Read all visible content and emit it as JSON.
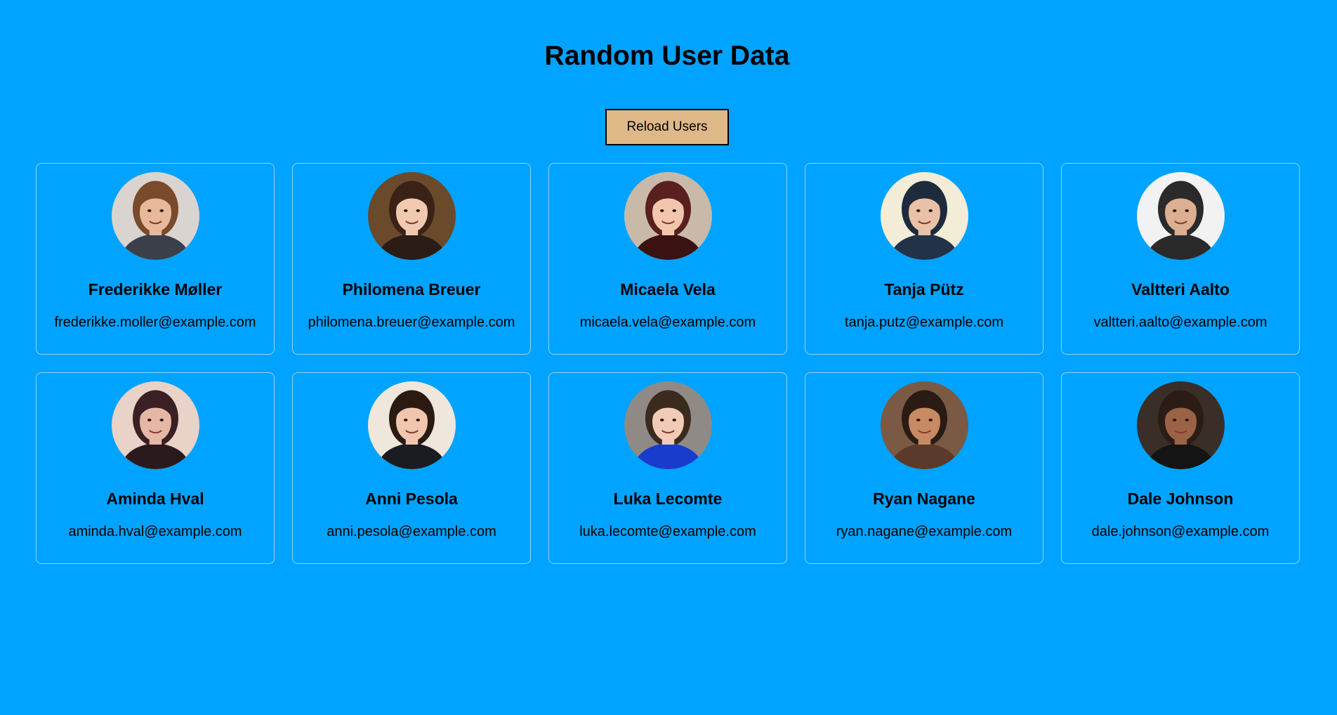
{
  "header": {
    "title": "Random User Data"
  },
  "toolbar": {
    "reload_label": "Reload Users"
  },
  "theme": {
    "background": "#00a3ff",
    "button_bg": "#deb887"
  },
  "users": [
    {
      "name": "Frederikke Møller",
      "email": "frederikke.moller@example.com",
      "avatar_icon": "user-avatar",
      "bg": "#d9d4cf",
      "skin": "#e7b99a",
      "hair": "#7a4a2c",
      "shirt": "#3b3f4a"
    },
    {
      "name": "Philomena Breuer",
      "email": "philomena.breuer@example.com",
      "avatar_icon": "user-avatar",
      "bg": "#6b4a2b",
      "skin": "#f0c9b0",
      "hair": "#3a2216",
      "shirt": "#2b1d16"
    },
    {
      "name": "Micaela Vela",
      "email": "micaela.vela@example.com",
      "avatar_icon": "user-avatar",
      "bg": "#c9b9a8",
      "skin": "#f1c6ad",
      "hair": "#5a1f1f",
      "shirt": "#3a1212"
    },
    {
      "name": "Tanja Pütz",
      "email": "tanja.putz@example.com",
      "avatar_icon": "user-avatar",
      "bg": "#f3ecd7",
      "skin": "#e9c1a8",
      "hair": "#1e2b3d",
      "shirt": "#223248"
    },
    {
      "name": "Valtteri Aalto",
      "email": "valtteri.aalto@example.com",
      "avatar_icon": "user-avatar",
      "bg": "#f2f2f2",
      "skin": "#dcae92",
      "hair": "#2a2a2a",
      "shirt": "#2a2a2a"
    },
    {
      "name": "Aminda Hval",
      "email": "aminda.hval@example.com",
      "avatar_icon": "user-avatar",
      "bg": "#e9d2c8",
      "skin": "#e6b7a6",
      "hair": "#3a1f24",
      "shirt": "#2a1a1e"
    },
    {
      "name": "Anni Pesola",
      "email": "anni.pesola@example.com",
      "avatar_icon": "user-avatar",
      "bg": "#efe6dc",
      "skin": "#f0c6ae",
      "hair": "#2b1a12",
      "shirt": "#1b1b22"
    },
    {
      "name": "Luka Lecomte",
      "email": "luka.lecomte@example.com",
      "avatar_icon": "user-avatar",
      "bg": "#8f8a86",
      "skin": "#f1cbb6",
      "hair": "#3b2a1e",
      "shirt": "#1a3ccc"
    },
    {
      "name": "Ryan Nagane",
      "email": "ryan.nagane@example.com",
      "avatar_icon": "user-avatar",
      "bg": "#7a5a44",
      "skin": "#c88a62",
      "hair": "#2a1c14",
      "shirt": "#5a3a2a"
    },
    {
      "name": "Dale Johnson",
      "email": "dale.johnson@example.com",
      "avatar_icon": "user-avatar",
      "bg": "#3a2e28",
      "skin": "#9a6346",
      "hair": "#2b1d16",
      "shirt": "#141414"
    }
  ]
}
